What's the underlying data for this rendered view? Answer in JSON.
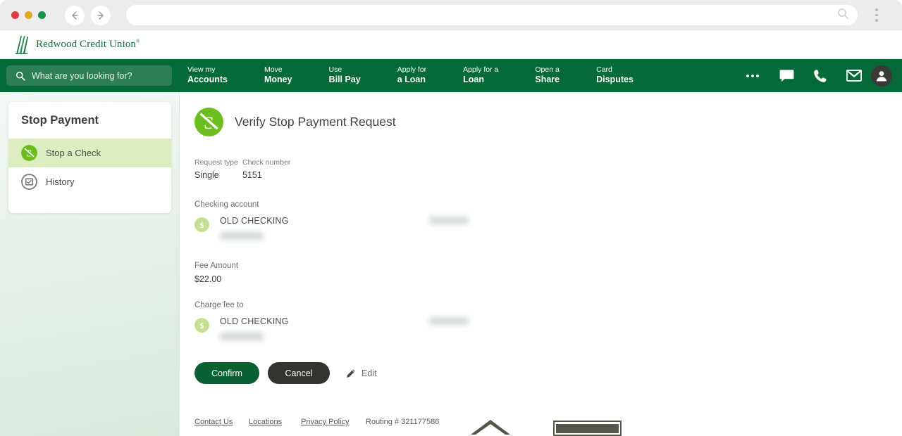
{
  "browser": {
    "traffic_lights": [
      "close",
      "minimize",
      "maximize"
    ],
    "back_icon": "back-arrow-icon",
    "forward_icon": "forward-arrow-icon",
    "url_value": "",
    "url_placeholder": "",
    "url_search_icon": "search-icon",
    "menu_icon": "kebab-menu-icon"
  },
  "site_header": {
    "logo_icon": "redwood-tree-logo-icon",
    "brand_name": "Redwood Credit Union",
    "brand_tm": "®"
  },
  "navbar": {
    "search_placeholder": "What are you looking for?",
    "search_icon": "search-icon",
    "links": [
      {
        "line1": "View my",
        "line2": "Accounts"
      },
      {
        "line1": "Move",
        "line2": "Money"
      },
      {
        "line1": "Use",
        "line2": "Bill Pay"
      },
      {
        "line1": "Apply for",
        "line2": "a Loan"
      },
      {
        "line1": "Apply for a",
        "line2": "Loan"
      },
      {
        "line1": "Open a",
        "line2": "Share"
      },
      {
        "line1": "Card",
        "line2": "Disputes"
      }
    ],
    "icons": [
      {
        "name": "more-options-icon"
      },
      {
        "name": "chat-icon"
      },
      {
        "name": "phone-icon"
      },
      {
        "name": "mail-icon"
      },
      {
        "name": "user-avatar-icon"
      }
    ],
    "bar_color": "#046a38",
    "search_bg_color": "#2c7f55"
  },
  "sidebar": {
    "title": "Stop Payment",
    "items": [
      {
        "label": "Stop a Check",
        "icon": "stop-payment-icon",
        "active": true
      },
      {
        "label": "History",
        "icon": "history-icon",
        "active": false
      }
    ],
    "active_bg_color": "#dcedbf"
  },
  "main": {
    "page_icon": "stop-payment-icon",
    "page_title": "Verify Stop Payment Request",
    "request_type_label": "Request type",
    "request_type_value": "Single",
    "check_number_label": "Check number",
    "check_number_value": "5151",
    "checking_account_label": "Checking account",
    "checking_account_name": "OLD CHECKING",
    "checking_account_number": "[redacted]",
    "checking_account_balance": "[redacted]",
    "fee_amount_label": "Fee Amount",
    "fee_amount_value": "$22.00",
    "charge_fee_to_label": "Charge fee to",
    "charge_fee_account_name": "OLD CHECKING",
    "charge_fee_account_number": "[redacted]",
    "charge_fee_balance": "[redacted]",
    "confirm_label": "Confirm",
    "cancel_label": "Cancel",
    "edit_label": "Edit",
    "edit_icon": "pencil-icon",
    "confirm_color": "#0a6234",
    "cancel_color": "#333330"
  },
  "footer": {
    "links": [
      "Contact Us",
      "Locations",
      "Privacy Policy"
    ],
    "routing_text": "Routing # 321177586",
    "badges": [
      {
        "name": "equal-housing-lender-icon"
      },
      {
        "name": "ncua-insured-plaque-icon"
      }
    ]
  }
}
